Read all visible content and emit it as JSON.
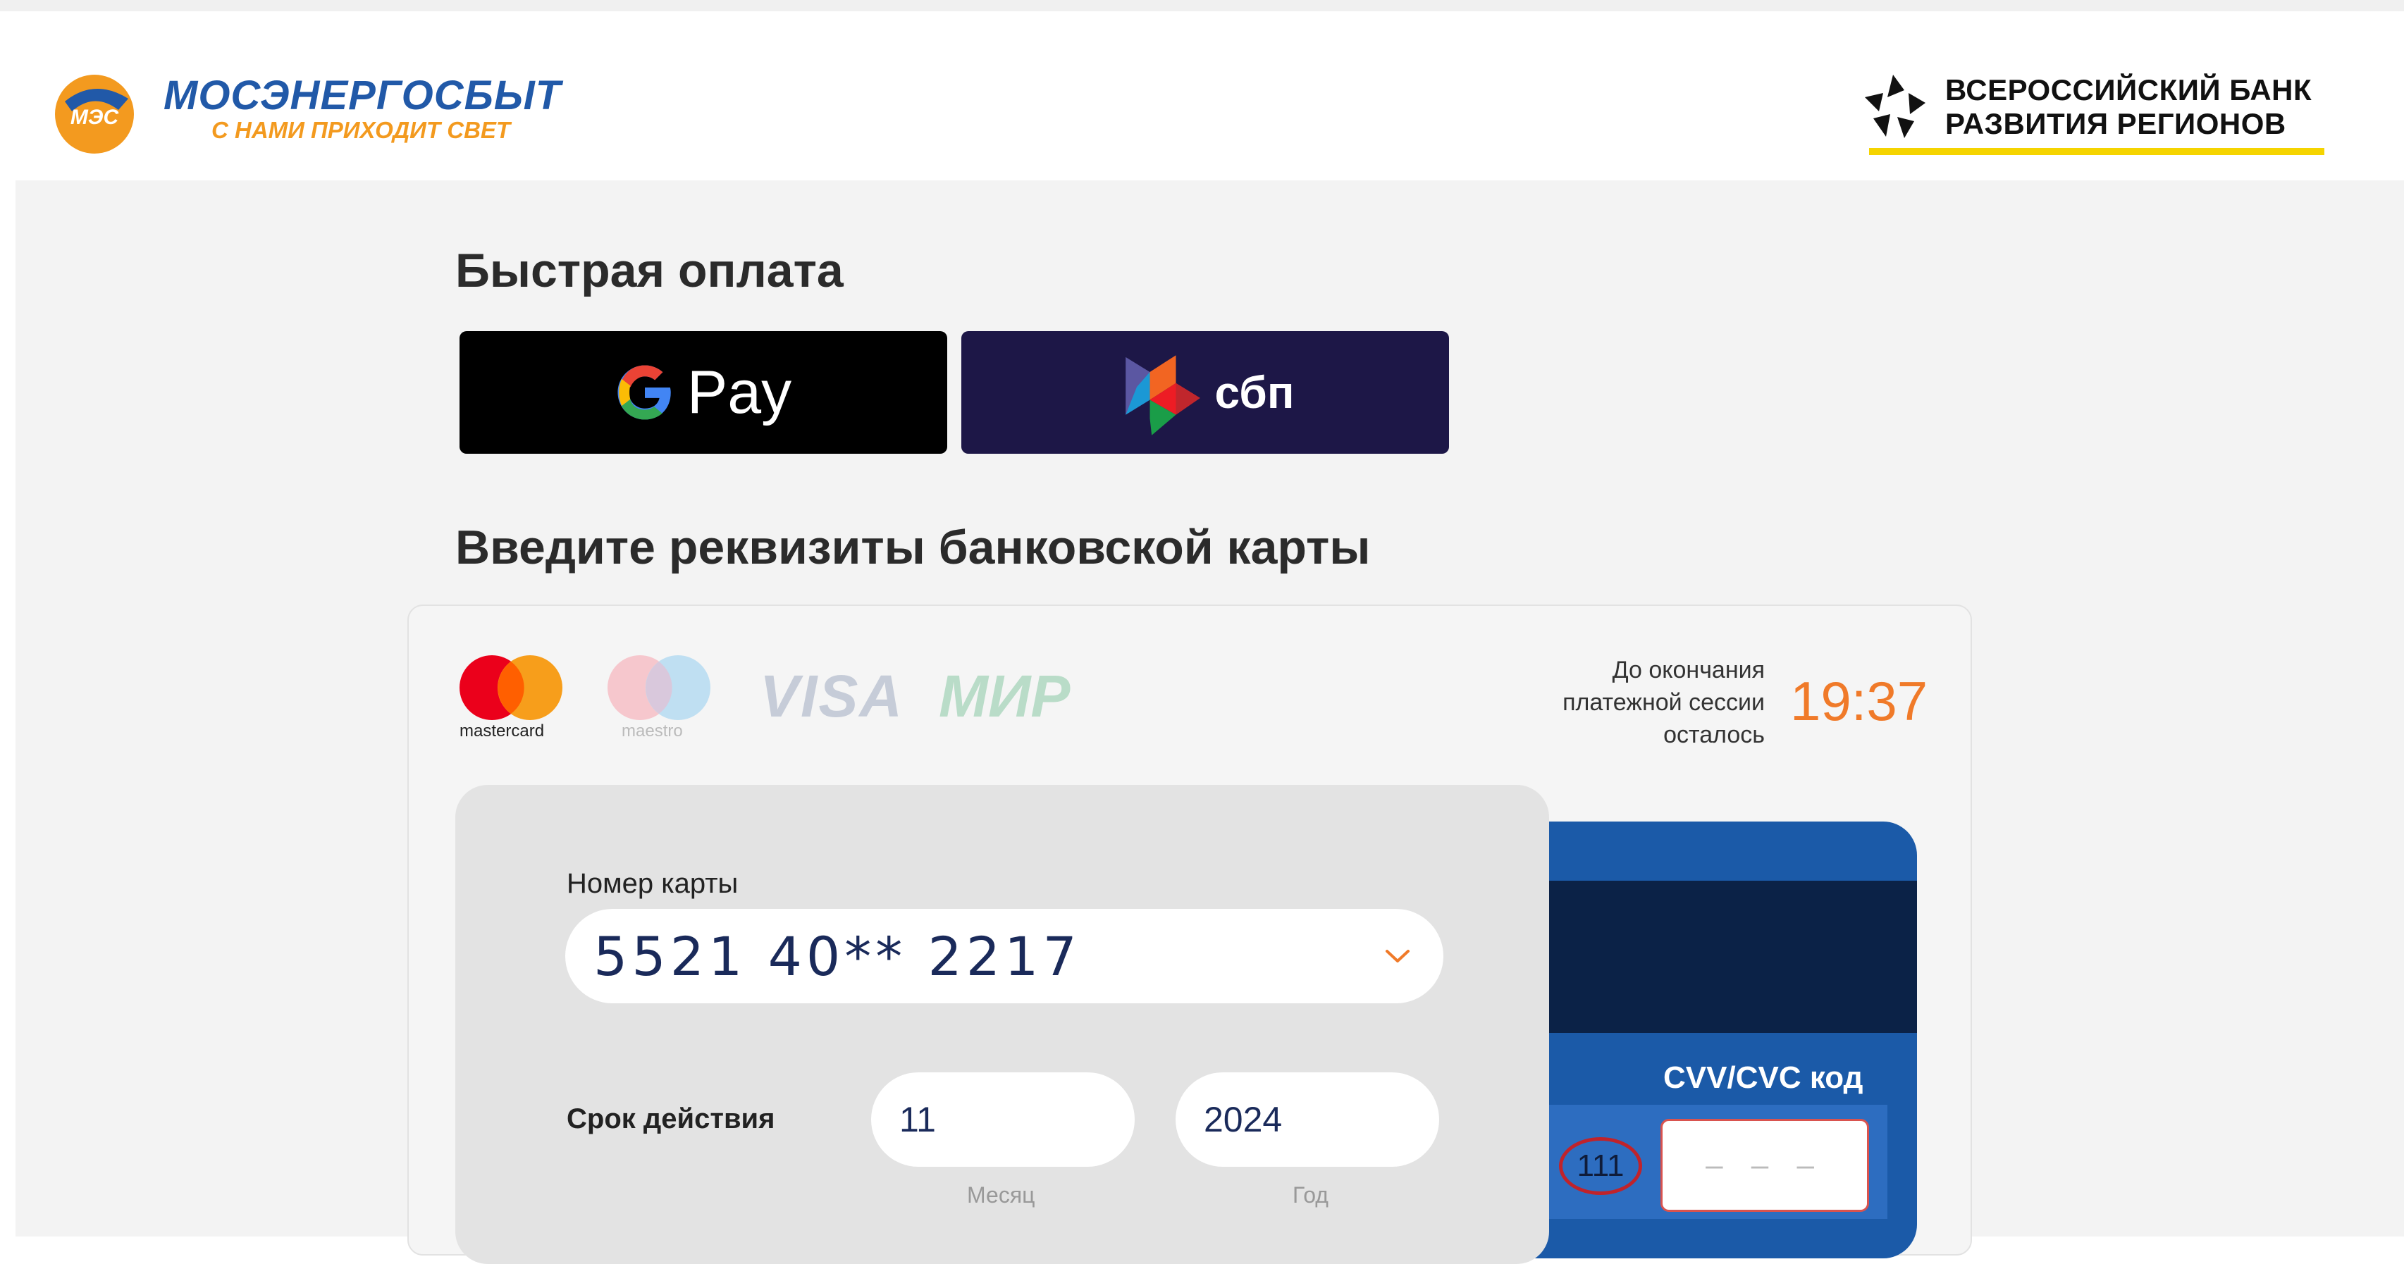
{
  "header": {
    "mes_abbr": "МЭС",
    "mes_name": "МОСЭНЕРГОСБЫТ",
    "mes_slogan": "С НАМИ ПРИХОДИТ СВЕТ",
    "bank_line1": "ВСЕРОССИЙСКИЙ БАНК",
    "bank_line2": "РАЗВИТИЯ РЕГИОНОВ"
  },
  "quick_pay": {
    "title": "Быстрая оплата",
    "gpay_label": "Pay",
    "sbp_label": "сбп"
  },
  "card_form": {
    "title": "Введите реквизиты банковской карты",
    "brands": {
      "mastercard": "mastercard",
      "maestro": "maestro",
      "visa": "VISA",
      "mir": "МИР"
    },
    "timer_label_1": "До окончания",
    "timer_label_2": "платежной сессии",
    "timer_label_3": "осталось",
    "timer_value": "19:37",
    "card_number_label": "Номер карты",
    "card_number_value": "5521 40** 2217",
    "expiry_label": "Срок действия",
    "month_value": "11",
    "year_value": "2024",
    "month_hint": "Месяц",
    "year_hint": "Год",
    "cvv_label": "CVV/CVC код",
    "cvv_sample": "111",
    "cvv_placeholder": "– – –"
  },
  "colors": {
    "accent_orange": "#f07a29",
    "mes_blue": "#2159a8",
    "sbp_bg": "#1d1747",
    "card_back_blue": "#1b5aa8",
    "vbrr_yellow": "#f5d400"
  }
}
